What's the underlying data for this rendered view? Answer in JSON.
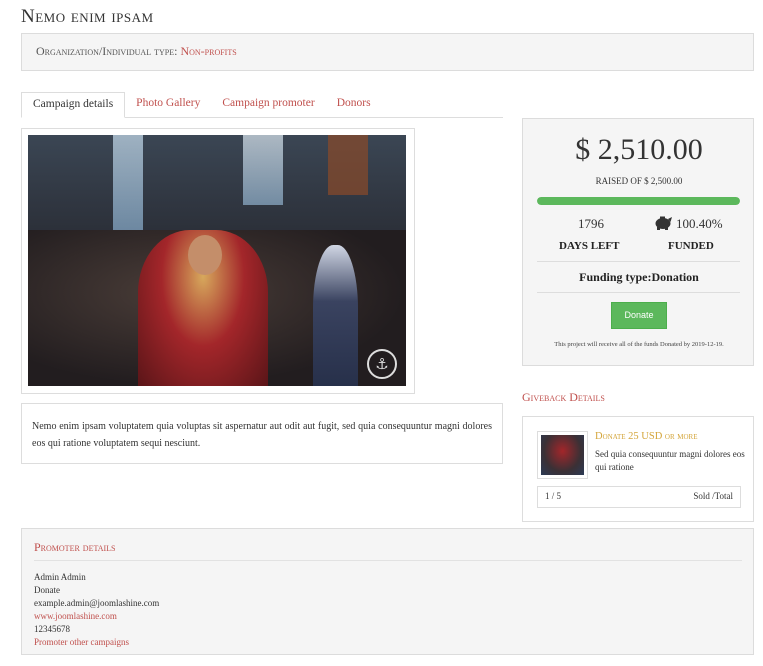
{
  "title": "Nemo enim ipsam",
  "organization": {
    "label": "Organization/Individual type:",
    "value": "Non-profits"
  },
  "tabs": [
    {
      "label": "Campaign details",
      "active": true
    },
    {
      "label": "Photo Gallery",
      "active": false
    },
    {
      "label": "Campaign promoter",
      "active": false
    },
    {
      "label": "Donors",
      "active": false
    }
  ],
  "description": "Nemo enim ipsam voluptatem quia voluptas sit aspernatur aut odit aut fugit, sed quia consequuntur magni dolores eos qui ratione voluptatem sequi nesciunt.",
  "funding": {
    "raised": "$ 2,510.00",
    "raised_of": "RAISED OF  $ 2,500.00",
    "progress_percent": 100,
    "days_left_value": "1796",
    "days_left_label": "DAYS LEFT",
    "funded_value": "100.40%",
    "funded_label": "FUNDED",
    "funding_type": "Funding type:Donation",
    "donate_label": "Donate",
    "note": "This project will receive all of the funds Donated by 2019-12-19.",
    "accent_color": "#5cb85c"
  },
  "giveback": {
    "title": "Giveback Details",
    "item_title": "Donate 25 USD or more",
    "item_desc": "Sed quia consequuntur magni dolores eos qui ratione",
    "sold": "1 / 5",
    "sold_label": "Sold /Total"
  },
  "promoter": {
    "title": "Promoter details",
    "name": "Admin Admin",
    "type": "Donate",
    "email": "example.admin@joomlashine.com",
    "website": "www.joomlashine.com",
    "phone": "12345678",
    "other_campaigns": "Promoter other campaigns"
  },
  "icons": {
    "funded": "piggy-bank-icon",
    "photo_watermark": "ship-logo-icon"
  },
  "colors": {
    "link": "#c0504d",
    "gold": "#d4a53a"
  }
}
